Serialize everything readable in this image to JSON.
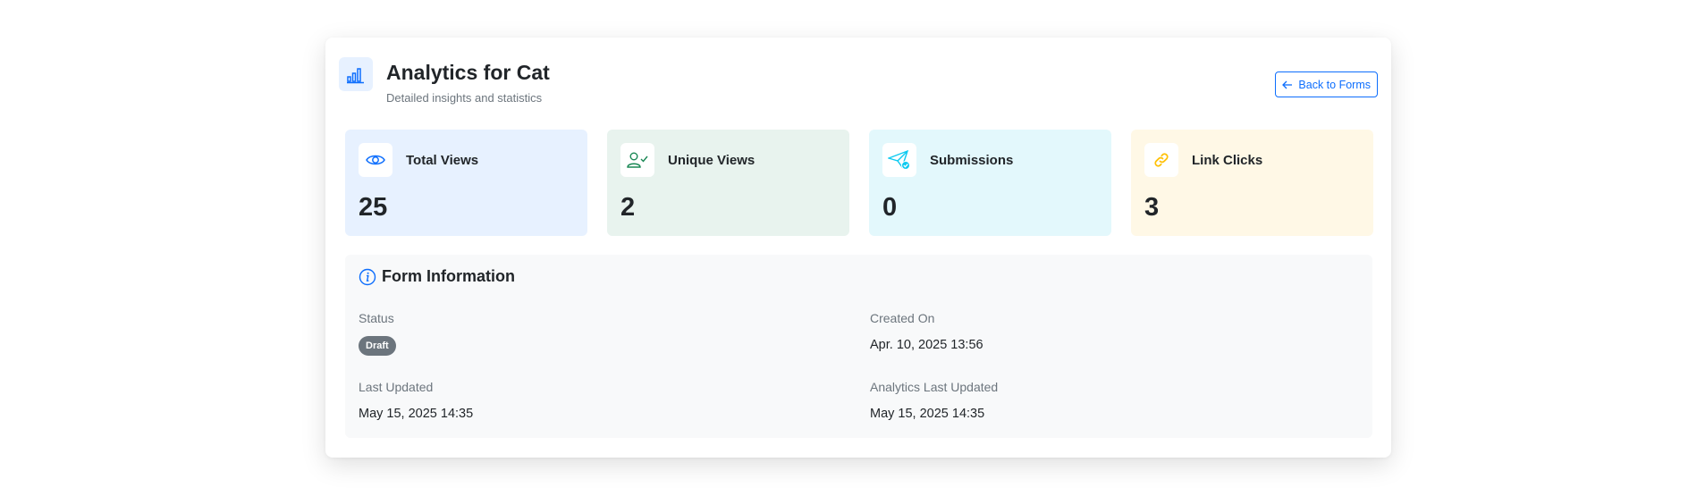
{
  "header": {
    "title": "Analytics for Cat",
    "subtitle": "Detailed insights and statistics",
    "icon": "bar-chart-icon",
    "back_label": "Back to Forms",
    "back_icon": "arrow-left-icon"
  },
  "stats": [
    {
      "label": "Total Views",
      "value": "25",
      "icon": "eye-icon",
      "bg": "#e7f1ff",
      "icon_color": "#0d6efd"
    },
    {
      "label": "Unique Views",
      "value": "2",
      "icon": "user-check-icon",
      "bg": "#e8f3ee",
      "icon_color": "#198754"
    },
    {
      "label": "Submissions",
      "value": "0",
      "icon": "send-icon",
      "bg": "#e3f8fc",
      "icon_color": "#0dcaf0"
    },
    {
      "label": "Link Clicks",
      "value": "3",
      "icon": "link-icon",
      "bg": "#fff8e6",
      "icon_color": "#ffc107"
    }
  ],
  "info": {
    "title": "Form Information",
    "icon": "info-icon",
    "status_label": "Status",
    "status_value": "Draft",
    "created_label": "Created On",
    "created_value": "Apr. 10, 2025 13:56",
    "updated_label": "Last Updated",
    "updated_value": "May 15, 2025 14:35",
    "analytics_label": "Analytics Last Updated",
    "analytics_value": "May 15, 2025 14:35"
  },
  "colors": {
    "primary": "#0d6efd",
    "secondary": "#6c757d"
  }
}
